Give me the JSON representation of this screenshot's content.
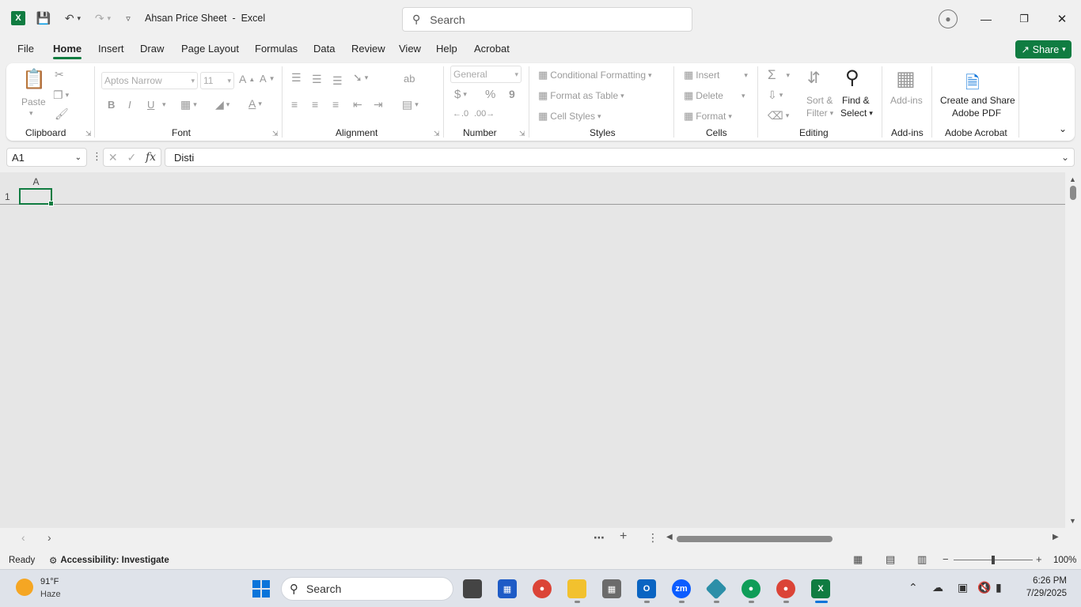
{
  "titlebar": {
    "doc_title": "Ahsan Price Sheet  -  Excel",
    "search_placeholder": "Search",
    "logo_letter": "X"
  },
  "tabs": [
    "File",
    "Home",
    "Insert",
    "Draw",
    "Page Layout",
    "Formulas",
    "Data",
    "Review",
    "View",
    "Help",
    "Acrobat"
  ],
  "active_tab": "Home",
  "share_label": "Share",
  "ribbon": {
    "clipboard": {
      "paste": "Paste",
      "label": "Clipboard"
    },
    "font": {
      "name": "Aptos Narrow",
      "size": "11",
      "label": "Font",
      "bold": "B",
      "italic": "I",
      "underline": "U"
    },
    "alignment": {
      "label": "Alignment"
    },
    "number": {
      "format": "General",
      "label": "Number",
      "currency": "$",
      "percent": "%",
      "comma": "9"
    },
    "styles": {
      "conditional": "Conditional Formatting",
      "table": "Format as Table",
      "cell": "Cell Styles",
      "label": "Styles"
    },
    "cells": {
      "insert": "Insert",
      "delete": "Delete",
      "format": "Format",
      "label": "Cells"
    },
    "editing": {
      "sort1": "Sort &",
      "sort2": "Filter",
      "find1": "Find &",
      "find2": "Select",
      "label": "Editing"
    },
    "addins": {
      "button": "Add-ins",
      "label": "Add-ins"
    },
    "acrobat": {
      "line1": "Create and Share",
      "line2": "Adobe PDF",
      "label": "Adobe Acrobat"
    }
  },
  "formula_bar": {
    "name_box": "A1",
    "fx": "fx",
    "content": "Disti"
  },
  "grid": {
    "column_header": "A",
    "row_header": "1"
  },
  "statusbar": {
    "ready": "Ready",
    "accessibility": "Accessibility: Investigate",
    "zoom": "100%"
  },
  "taskbar": {
    "temp": "91°F",
    "weather": "Haze",
    "search": "Search",
    "time": "6:26 PM",
    "date": "7/29/2025"
  },
  "colors": {
    "accent": "#107c41",
    "save": "#a4373a"
  }
}
